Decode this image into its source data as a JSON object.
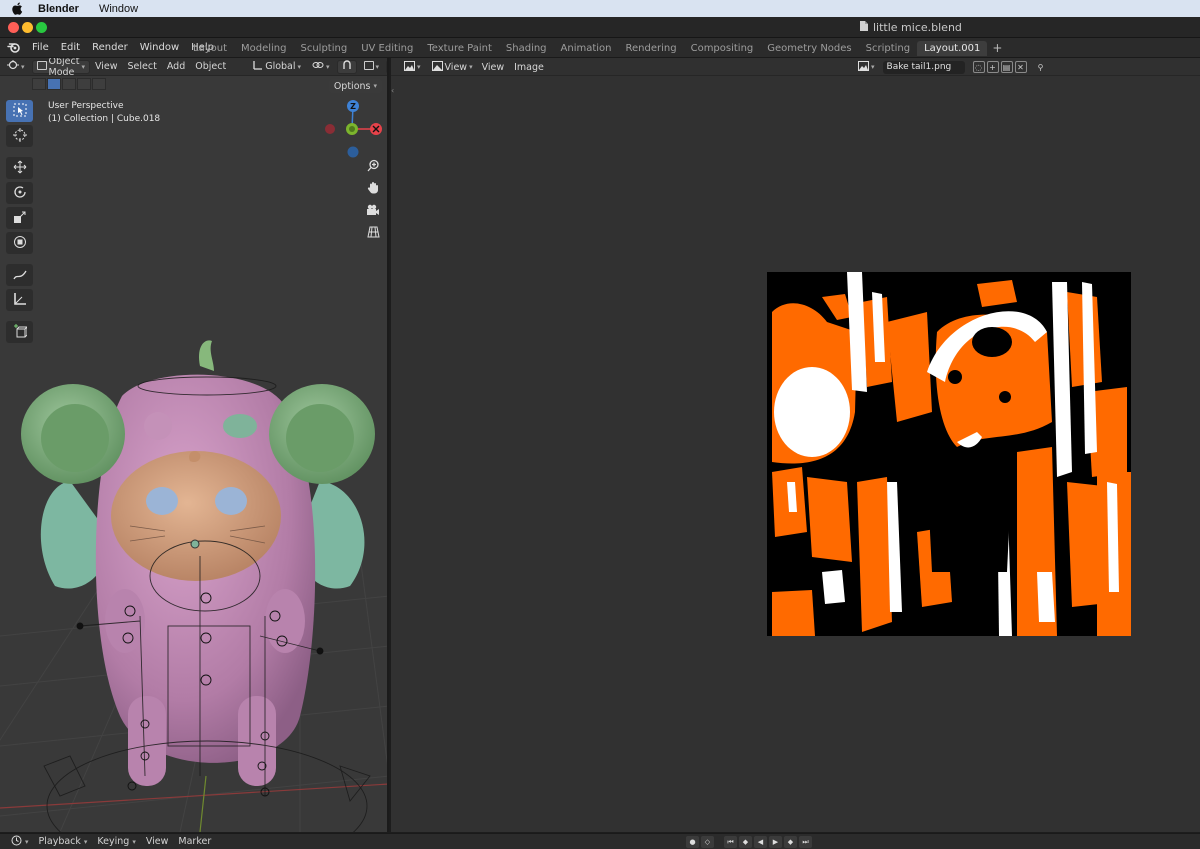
{
  "mac_menubar": {
    "app_name": "Blender",
    "menu_window": "Window"
  },
  "window": {
    "title": "little mice.blend"
  },
  "topbar": {
    "menus": [
      "File",
      "Edit",
      "Render",
      "Window",
      "Help"
    ],
    "workspaces": [
      "Layout",
      "Modeling",
      "Sculpting",
      "UV Editing",
      "Texture Paint",
      "Shading",
      "Animation",
      "Rendering",
      "Compositing",
      "Geometry Nodes",
      "Scripting",
      "Layout.001"
    ],
    "active_workspace": "Layout.001",
    "add_label": "+"
  },
  "viewport": {
    "mode": "Object Mode",
    "menus": [
      "View",
      "Select",
      "Add",
      "Object"
    ],
    "transform_orientation": "Global",
    "options_label": "Options",
    "view_name": "User Perspective",
    "collection_info": "(1) Collection | Cube.018",
    "gizmo": {
      "z": "Z",
      "x_color": "#e7424a",
      "y_color": "#7cb52d",
      "z_color": "#3e82d6"
    }
  },
  "image_editor": {
    "menus": [
      "View",
      "View",
      "Image"
    ],
    "image_name": "Bake tail1.png",
    "colors": {
      "orange": "#ff6a00",
      "white": "#ffffff",
      "black": "#000000"
    }
  },
  "timeline": {
    "menus": [
      "Playback",
      "Keying",
      "View",
      "Marker"
    ]
  },
  "icons": {
    "editor_type": "3d-viewport-icon",
    "select_tool": "cursor-select-icon",
    "transform_tools": [
      "cursor-icon",
      "move-icon",
      "rotate-icon",
      "scale-icon",
      "transform-icon",
      "annotate-icon",
      "measure-icon",
      "add-cube-icon"
    ],
    "nav": [
      "zoom-icon",
      "hand-pan-icon",
      "camera-icon",
      "grid-ortho-icon"
    ]
  }
}
